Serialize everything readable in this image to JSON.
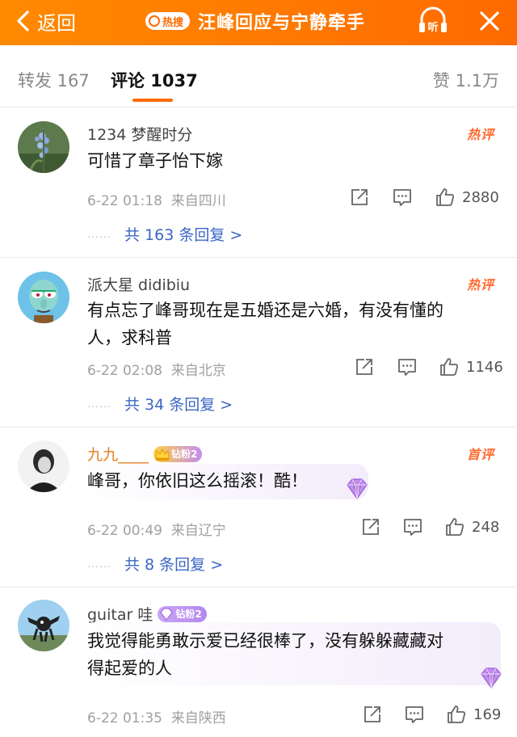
{
  "header": {
    "back_label": "返回",
    "hot_tag": "热搜",
    "title": "汪峰回应与宁静牵手",
    "listen_label": "听"
  },
  "tabs": {
    "repost": "转发 167",
    "comments": "评论 1037",
    "likes": "赞 1.1万"
  },
  "comments": [
    {
      "username": "1234 梦醒时分",
      "tag": "热评",
      "text": "可惜了章子怡下嫁",
      "time": "6-22 01:18",
      "location": "来自四川",
      "likes": "2880",
      "replies": "共 163 条回复 >"
    },
    {
      "username": "派大星 didibiu",
      "tag": "热评",
      "text_line1": "有点忘了峰哥现在是五婚还是六婚，有没有懂的",
      "text_line2": "人，求科普",
      "time": "6-22 02:08",
      "location": "来自北京",
      "likes": "1146",
      "replies": "共 34 条回复 >"
    },
    {
      "username": "九九____",
      "fan_badge": "钻粉2",
      "tag": "首评",
      "text": "峰哥，你依旧这么摇滚！酷！",
      "time": "6-22 00:49",
      "location": "来自辽宁",
      "likes": "248",
      "replies": "共 8 条回复 >"
    },
    {
      "username": "guitar 哇",
      "fan_badge": "钻粉2",
      "text_line1": "我觉得能勇敢示爱已经很棒了，没有躲躲藏藏对",
      "text_line2": "得起爱的人",
      "time": "6-22 01:35",
      "location": "来自陕西",
      "likes": "169"
    }
  ],
  "reply_dots": "……",
  "colors": {
    "brand_orange": "#ff6a00",
    "link_blue": "#3b66c5",
    "hot_tag": "#ff6a2e"
  },
  "icons": [
    "back-chevron-icon",
    "listen-icon",
    "close-icon",
    "share-icon",
    "comment-icon",
    "like-icon",
    "crown-icon",
    "diamond-gem-icon"
  ]
}
